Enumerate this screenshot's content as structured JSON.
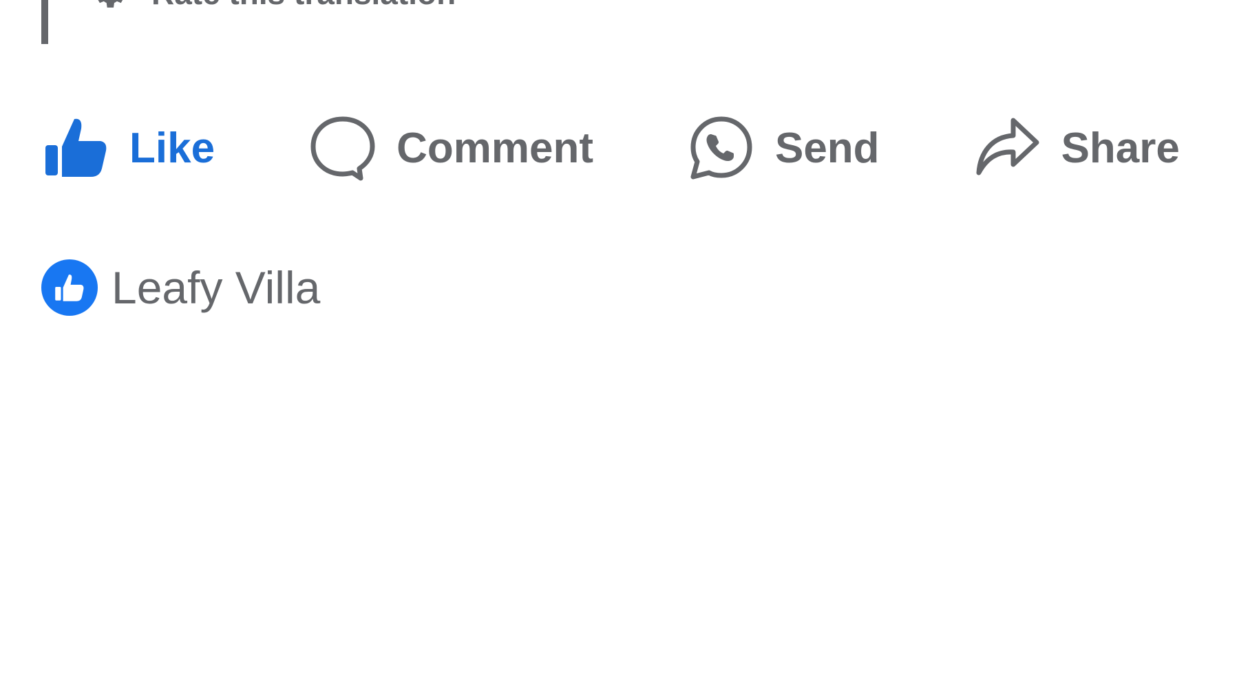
{
  "translation": {
    "rate_label": "Rate this translation"
  },
  "actions": {
    "like_label": "Like",
    "comment_label": "Comment",
    "send_label": "Send",
    "share_label": "Share"
  },
  "reactions": {
    "liked_by": "Leafy Villa"
  },
  "icons": {
    "gear": "gear-icon",
    "like": "thumbs-up-icon",
    "comment": "comment-bubble-icon",
    "send": "whatsapp-icon",
    "share": "share-arrow-icon",
    "reaction": "like-reaction-icon"
  },
  "colors": {
    "accent": "#1a6ed8",
    "reaction_badge": "#1877f2",
    "text_secondary": "#65676b",
    "background": "#ffffff"
  }
}
